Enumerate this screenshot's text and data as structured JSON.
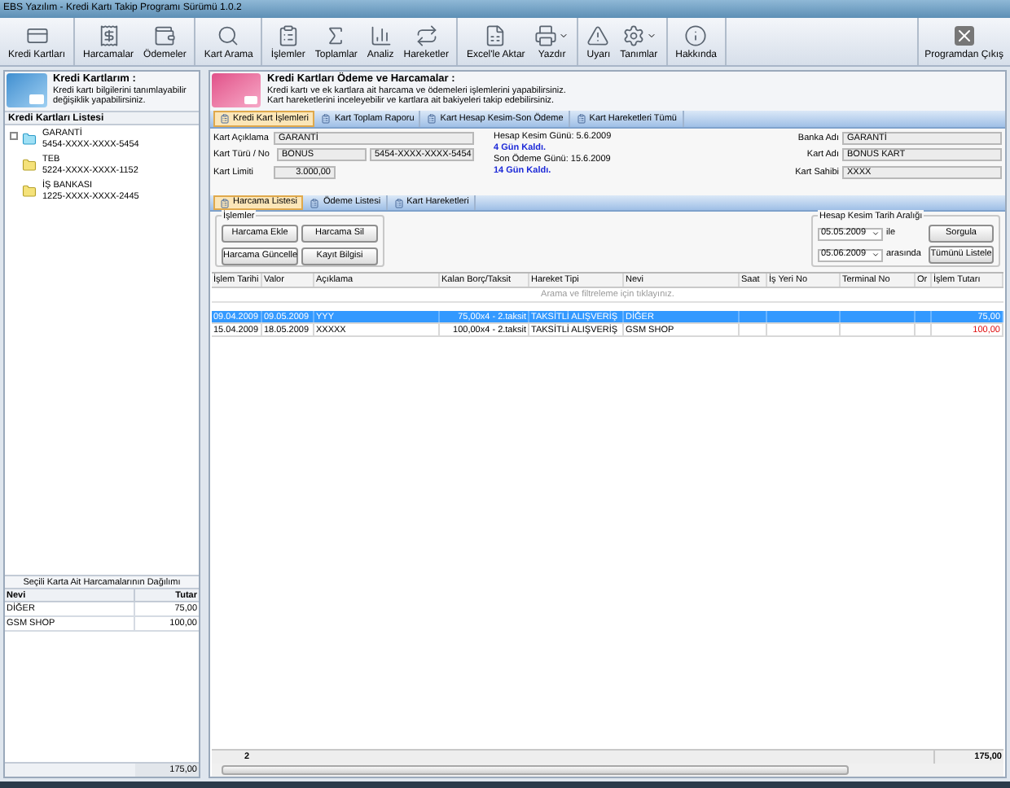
{
  "window": {
    "title": "EBS Yazılım  - Kredi Kartı Takip Programı Sürümü 1.0.2"
  },
  "toolbar": {
    "groups": [
      [
        {
          "label": "Kredi Kartları",
          "dropdown": false
        }
      ],
      [
        {
          "label": "Harcamalar",
          "dropdown": false
        },
        {
          "label": "Ödemeler",
          "dropdown": false
        }
      ],
      [
        {
          "label": "Kart Arama",
          "dropdown": false
        }
      ],
      [
        {
          "label": "İşlemler",
          "dropdown": false
        },
        {
          "label": "Toplamlar",
          "dropdown": false
        },
        {
          "label": "Analiz",
          "dropdown": false
        },
        {
          "label": "Hareketler",
          "dropdown": false
        }
      ],
      [
        {
          "label": "Excel'le Aktar",
          "dropdown": false
        },
        {
          "label": "Yazdır",
          "dropdown": true
        }
      ],
      [
        {
          "label": "Uyarı",
          "dropdown": false
        },
        {
          "label": "Tanımlar",
          "dropdown": true
        }
      ],
      [
        {
          "label": "Hakkında",
          "dropdown": false
        }
      ]
    ],
    "exit": {
      "label": "Programdan Çıkış"
    }
  },
  "left": {
    "header": {
      "title": "Kredi Kartlarım :",
      "description": "Kredi kartı bilgilerini tanımlayabilir değişiklik yapabilirsiniz."
    },
    "list_title": "Kredi Kartları Listesi",
    "cards": [
      {
        "name": "GARANTİ",
        "number": "5454-XXXX-XXXX-5454",
        "selected": true,
        "expander": true
      },
      {
        "name": "TEB",
        "number": "5224-XXXX-XXXX-1152",
        "selected": false,
        "expander": false
      },
      {
        "name": "İŞ BANKASI",
        "number": "1225-XXXX-XXXX-2445",
        "selected": false,
        "expander": false
      }
    ],
    "distribution": {
      "title": "Seçili Karta Ait Harcamalarının Dağılımı",
      "columns": [
        "Nevi",
        "Tutar"
      ],
      "rows": [
        [
          "DİĞER",
          "75,00"
        ],
        [
          "GSM SHOP",
          "100,00"
        ]
      ],
      "total": "175,00"
    }
  },
  "right": {
    "header": {
      "title": "Kredi Kartları Ödeme ve Harcamalar :",
      "lines": [
        "Kredi kartı ve ek kartlara ait harcama ve ödemeleri  işlemlerini yapabilirsiniz.",
        "Kart hareketlerini inceleyebilir ve kartlara ait bakiyeleri takip edebilirsiniz."
      ]
    },
    "tabs": [
      {
        "label": "Kredi Kart İşlemleri",
        "selected": true
      },
      {
        "label": "Kart Toplam Raporu",
        "selected": false
      },
      {
        "label": "Kart Hesap Kesim-Son Ödeme",
        "selected": false
      },
      {
        "label": "Kart Hareketleri Tümü",
        "selected": false
      }
    ],
    "form": {
      "kart_aciklama": {
        "label": "Kart Açıklama",
        "value": "GARANTİ"
      },
      "kart_turu": {
        "label": "Kart Türü / No",
        "value": "BONUS",
        "number": "5454-XXXX-XXXX-5454"
      },
      "kart_limiti": {
        "label": "Kart Limiti",
        "value": "3.000,00"
      },
      "hesap_kesim": "Hesap Kesim Günü: 5.6.2009",
      "hesap_kesim_kalan": "4 Gün Kaldı.",
      "son_odeme": "Son Ödeme Günü: 15.6.2009",
      "son_odeme_kalan": "14 Gün Kaldı.",
      "banka_adi": {
        "label": "Banka Adı",
        "value": "GARANTİ"
      },
      "kart_adi": {
        "label": "Kart Adı",
        "value": "BONUS KART"
      },
      "kart_sahibi": {
        "label": "Kart Sahibi",
        "value": "XXXX"
      }
    },
    "subtabs": [
      {
        "label": "Harcama Listesi",
        "selected": true
      },
      {
        "label": "Ödeme Listesi",
        "selected": false
      },
      {
        "label": "Kart Hareketleri",
        "selected": false
      }
    ],
    "operations": {
      "title": "İşlemler",
      "buttons": [
        "Harcama Ekle",
        "Harcama Sil",
        "Harcama Güncelle",
        "Kayıt Bilgisi"
      ]
    },
    "date_range": {
      "title": "Hesap Kesim Tarih Aralığı",
      "from": "05.05.2009",
      "from_suffix": "ile",
      "to": "05.06.2009",
      "to_suffix": "arasında",
      "buttons": [
        "Sorgula",
        "Tümünü Listele"
      ]
    },
    "grid": {
      "columns": [
        "İşlem Tarihi",
        "Valor",
        "Açıklama",
        "Kalan Borç/Taksit",
        "Hareket Tipi",
        "Nevi",
        "Saat",
        "İş Yeri No",
        "Terminal No",
        "Or",
        "İşlem Tutarı"
      ],
      "filter_hint": "Arama ve filtreleme için tıklayınız.",
      "rows": [
        {
          "selected": true,
          "cells": [
            "09.04.2009",
            "09.05.2009",
            "YYY",
            "75,00x4 - 2.taksit",
            "TAKSİTLİ ALIŞVERİŞ",
            "DİĞER",
            "",
            "",
            "",
            "",
            "75,00"
          ]
        },
        {
          "selected": false,
          "cells": [
            "15.04.2009",
            "18.05.2009",
            "XXXXX",
            "100,00x4 - 2.taksit",
            "TAKSİTLİ ALIŞVERİŞ",
            "GSM SHOP",
            "",
            "",
            "",
            "",
            "100,00"
          ]
        }
      ],
      "footer_count": "2",
      "footer_total": "175,00"
    }
  }
}
